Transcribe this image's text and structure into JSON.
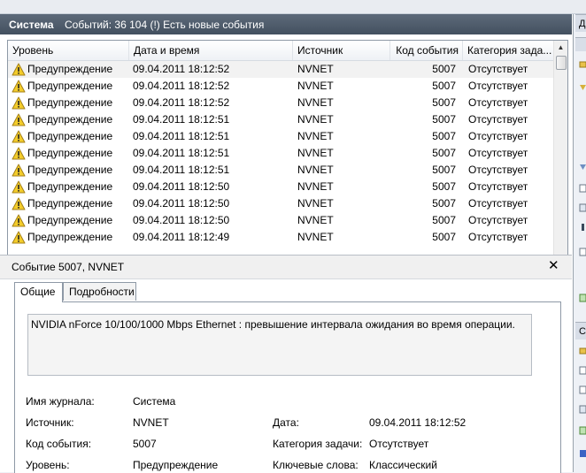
{
  "header": {
    "log_name": "Система",
    "status": "Событий: 36 104 (!) Есть новые события"
  },
  "columns": [
    "Уровень",
    "Дата и время",
    "Источник",
    "Код события",
    "Категория зада..."
  ],
  "events": [
    {
      "level": "Предупреждение",
      "date": "09.04.2011 18:12:52",
      "source": "NVNET",
      "id": "5007",
      "category": "Отсутствует"
    },
    {
      "level": "Предупреждение",
      "date": "09.04.2011 18:12:52",
      "source": "NVNET",
      "id": "5007",
      "category": "Отсутствует"
    },
    {
      "level": "Предупреждение",
      "date": "09.04.2011 18:12:52",
      "source": "NVNET",
      "id": "5007",
      "category": "Отсутствует"
    },
    {
      "level": "Предупреждение",
      "date": "09.04.2011 18:12:51",
      "source": "NVNET",
      "id": "5007",
      "category": "Отсутствует"
    },
    {
      "level": "Предупреждение",
      "date": "09.04.2011 18:12:51",
      "source": "NVNET",
      "id": "5007",
      "category": "Отсутствует"
    },
    {
      "level": "Предупреждение",
      "date": "09.04.2011 18:12:51",
      "source": "NVNET",
      "id": "5007",
      "category": "Отсутствует"
    },
    {
      "level": "Предупреждение",
      "date": "09.04.2011 18:12:51",
      "source": "NVNET",
      "id": "5007",
      "category": "Отсутствует"
    },
    {
      "level": "Предупреждение",
      "date": "09.04.2011 18:12:50",
      "source": "NVNET",
      "id": "5007",
      "category": "Отсутствует"
    },
    {
      "level": "Предупреждение",
      "date": "09.04.2011 18:12:50",
      "source": "NVNET",
      "id": "5007",
      "category": "Отсутствует"
    },
    {
      "level": "Предупреждение",
      "date": "09.04.2011 18:12:50",
      "source": "NVNET",
      "id": "5007",
      "category": "Отсутствует"
    },
    {
      "level": "Предупреждение",
      "date": "09.04.2011 18:12:49",
      "source": "NVNET",
      "id": "5007",
      "category": "Отсутствует"
    }
  ],
  "detail": {
    "title": "Событие 5007, NVNET",
    "tabs": [
      "Общие",
      "Подробности"
    ],
    "message": "NVIDIA nForce 10/100/1000 Mbps Ethernet  : превышение интервала ожидания во время операции.",
    "log_name_label": "Имя журнала:",
    "log_name_value": "Система",
    "source_label": "Источник:",
    "source_value": "NVNET",
    "date_label": "Дата:",
    "date_value": "09.04.2011 18:12:52",
    "event_id_label": "Код события:",
    "event_id_value": "5007",
    "task_category_label": "Категория задачи:",
    "task_category_value": "Отсутствует",
    "level_label": "Уровень:",
    "level_value": "Предупреждение",
    "keywords_label": "Ключевые слова:",
    "keywords_value": "Классический"
  },
  "actions_panel": {
    "header_1": "Д",
    "header_2": "С"
  },
  "icons": {
    "row_level": "warning-icon",
    "close": "close-icon",
    "scroll_up": "scroll-up-arrow-icon",
    "scroll_down": "scroll-down-arrow-icon"
  }
}
